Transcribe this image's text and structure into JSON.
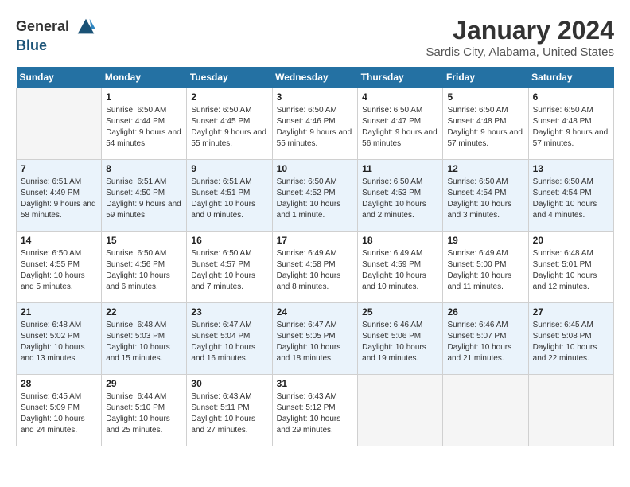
{
  "header": {
    "logo_line1": "General",
    "logo_line2": "Blue",
    "title": "January 2024",
    "subtitle": "Sardis City, Alabama, United States"
  },
  "weekdays": [
    "Sunday",
    "Monday",
    "Tuesday",
    "Wednesday",
    "Thursday",
    "Friday",
    "Saturday"
  ],
  "weeks": [
    [
      {
        "day": "",
        "sunrise": "",
        "sunset": "",
        "daylight": ""
      },
      {
        "day": "1",
        "sunrise": "6:50 AM",
        "sunset": "4:44 PM",
        "daylight": "9 hours and 54 minutes."
      },
      {
        "day": "2",
        "sunrise": "6:50 AM",
        "sunset": "4:45 PM",
        "daylight": "9 hours and 55 minutes."
      },
      {
        "day": "3",
        "sunrise": "6:50 AM",
        "sunset": "4:46 PM",
        "daylight": "9 hours and 55 minutes."
      },
      {
        "day": "4",
        "sunrise": "6:50 AM",
        "sunset": "4:47 PM",
        "daylight": "9 hours and 56 minutes."
      },
      {
        "day": "5",
        "sunrise": "6:50 AM",
        "sunset": "4:48 PM",
        "daylight": "9 hours and 57 minutes."
      },
      {
        "day": "6",
        "sunrise": "6:50 AM",
        "sunset": "4:48 PM",
        "daylight": "9 hours and 57 minutes."
      }
    ],
    [
      {
        "day": "7",
        "sunrise": "6:51 AM",
        "sunset": "4:49 PM",
        "daylight": "9 hours and 58 minutes."
      },
      {
        "day": "8",
        "sunrise": "6:51 AM",
        "sunset": "4:50 PM",
        "daylight": "9 hours and 59 minutes."
      },
      {
        "day": "9",
        "sunrise": "6:51 AM",
        "sunset": "4:51 PM",
        "daylight": "10 hours and 0 minutes."
      },
      {
        "day": "10",
        "sunrise": "6:50 AM",
        "sunset": "4:52 PM",
        "daylight": "10 hours and 1 minute."
      },
      {
        "day": "11",
        "sunrise": "6:50 AM",
        "sunset": "4:53 PM",
        "daylight": "10 hours and 2 minutes."
      },
      {
        "day": "12",
        "sunrise": "6:50 AM",
        "sunset": "4:54 PM",
        "daylight": "10 hours and 3 minutes."
      },
      {
        "day": "13",
        "sunrise": "6:50 AM",
        "sunset": "4:54 PM",
        "daylight": "10 hours and 4 minutes."
      }
    ],
    [
      {
        "day": "14",
        "sunrise": "6:50 AM",
        "sunset": "4:55 PM",
        "daylight": "10 hours and 5 minutes."
      },
      {
        "day": "15",
        "sunrise": "6:50 AM",
        "sunset": "4:56 PM",
        "daylight": "10 hours and 6 minutes."
      },
      {
        "day": "16",
        "sunrise": "6:50 AM",
        "sunset": "4:57 PM",
        "daylight": "10 hours and 7 minutes."
      },
      {
        "day": "17",
        "sunrise": "6:49 AM",
        "sunset": "4:58 PM",
        "daylight": "10 hours and 8 minutes."
      },
      {
        "day": "18",
        "sunrise": "6:49 AM",
        "sunset": "4:59 PM",
        "daylight": "10 hours and 10 minutes."
      },
      {
        "day": "19",
        "sunrise": "6:49 AM",
        "sunset": "5:00 PM",
        "daylight": "10 hours and 11 minutes."
      },
      {
        "day": "20",
        "sunrise": "6:48 AM",
        "sunset": "5:01 PM",
        "daylight": "10 hours and 12 minutes."
      }
    ],
    [
      {
        "day": "21",
        "sunrise": "6:48 AM",
        "sunset": "5:02 PM",
        "daylight": "10 hours and 13 minutes."
      },
      {
        "day": "22",
        "sunrise": "6:48 AM",
        "sunset": "5:03 PM",
        "daylight": "10 hours and 15 minutes."
      },
      {
        "day": "23",
        "sunrise": "6:47 AM",
        "sunset": "5:04 PM",
        "daylight": "10 hours and 16 minutes."
      },
      {
        "day": "24",
        "sunrise": "6:47 AM",
        "sunset": "5:05 PM",
        "daylight": "10 hours and 18 minutes."
      },
      {
        "day": "25",
        "sunrise": "6:46 AM",
        "sunset": "5:06 PM",
        "daylight": "10 hours and 19 minutes."
      },
      {
        "day": "26",
        "sunrise": "6:46 AM",
        "sunset": "5:07 PM",
        "daylight": "10 hours and 21 minutes."
      },
      {
        "day": "27",
        "sunrise": "6:45 AM",
        "sunset": "5:08 PM",
        "daylight": "10 hours and 22 minutes."
      }
    ],
    [
      {
        "day": "28",
        "sunrise": "6:45 AM",
        "sunset": "5:09 PM",
        "daylight": "10 hours and 24 minutes."
      },
      {
        "day": "29",
        "sunrise": "6:44 AM",
        "sunset": "5:10 PM",
        "daylight": "10 hours and 25 minutes."
      },
      {
        "day": "30",
        "sunrise": "6:43 AM",
        "sunset": "5:11 PM",
        "daylight": "10 hours and 27 minutes."
      },
      {
        "day": "31",
        "sunrise": "6:43 AM",
        "sunset": "5:12 PM",
        "daylight": "10 hours and 29 minutes."
      },
      {
        "day": "",
        "sunrise": "",
        "sunset": "",
        "daylight": ""
      },
      {
        "day": "",
        "sunrise": "",
        "sunset": "",
        "daylight": ""
      },
      {
        "day": "",
        "sunrise": "",
        "sunset": "",
        "daylight": ""
      }
    ]
  ],
  "labels": {
    "sunrise": "Sunrise:",
    "sunset": "Sunset:",
    "daylight": "Daylight:"
  }
}
